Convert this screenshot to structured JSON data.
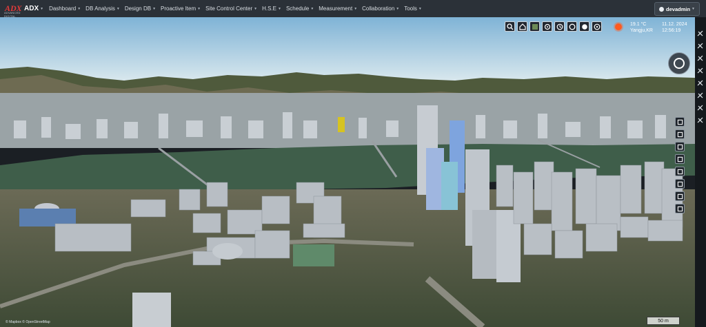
{
  "app": {
    "logo_text": "ADX",
    "logo_subtext": "ADVANCED DIGITAL",
    "title": "ADX"
  },
  "menu": [
    {
      "label": "Dashboard"
    },
    {
      "label": "DB Analysis"
    },
    {
      "label": "Design DB"
    },
    {
      "label": "Proactive Item"
    },
    {
      "label": "Site Control Center"
    },
    {
      "label": "H.S.E"
    },
    {
      "label": "Schedule"
    },
    {
      "label": "Measurement"
    },
    {
      "label": "Collaboration"
    },
    {
      "label": "Tools"
    }
  ],
  "user": {
    "name": "devadmin"
  },
  "map_toolbar": [
    {
      "icon": "search-icon"
    },
    {
      "icon": "home-icon"
    },
    {
      "icon": "satellite-icon"
    },
    {
      "icon": "layer-grid-icon"
    },
    {
      "icon": "clock-icon"
    },
    {
      "icon": "globe-outline-icon"
    },
    {
      "icon": "sun-toggle-icon"
    },
    {
      "icon": "target-icon"
    }
  ],
  "weather": {
    "temperature": "19.1 °C",
    "location": "Yangju,KR",
    "date": "11.12. 2024",
    "time": "12:56:19",
    "sun_color": "#ff5a1f"
  },
  "side_tools": [
    {
      "icon": "layers-icon"
    },
    {
      "icon": "measure-x-icon"
    },
    {
      "icon": "draw-line-icon"
    },
    {
      "icon": "edit-icon"
    },
    {
      "icon": "edit-alt-icon"
    },
    {
      "icon": "cube-icon"
    },
    {
      "icon": "send-icon"
    },
    {
      "icon": "link-icon"
    }
  ],
  "mid_tools": [
    {
      "icon": "minus-box-icon"
    },
    {
      "icon": "column-icon"
    },
    {
      "icon": "frame-icon"
    },
    {
      "icon": "box-3d-icon"
    },
    {
      "icon": "slope-icon"
    },
    {
      "icon": "warning-icon"
    },
    {
      "icon": "target-small-icon"
    },
    {
      "icon": "landscape-icon"
    }
  ],
  "map": {
    "attribution": "© Mapbox © OpenStreetMap",
    "scale_label": "50 m"
  },
  "colors": {
    "nav_bg": "#2b3138",
    "sky_top": "#7fb3d6",
    "sky_bottom": "#dbe9ee",
    "river": "#3f5e4a"
  }
}
